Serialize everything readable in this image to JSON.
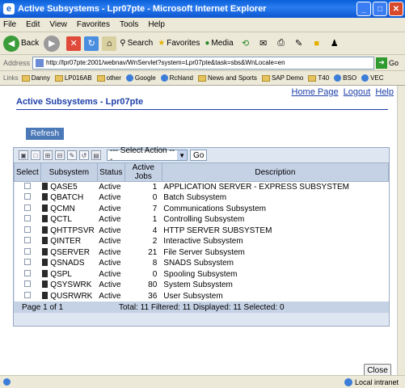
{
  "window": {
    "title": "Active Subsystems - Lpr07pte - Microsoft Internet Explorer",
    "icon": "ie-icon"
  },
  "menu": [
    "File",
    "Edit",
    "View",
    "Favorites",
    "Tools",
    "Help"
  ],
  "toolbar": {
    "back": "Back",
    "search": "Search",
    "favorites": "Favorites",
    "media": "Media"
  },
  "address": {
    "label": "Address",
    "url": "http://lpr07pte:2001/webnav/WnServlet?system=Lpr07pte&task=sbs&WnLocale=en",
    "go": "Go"
  },
  "links": {
    "label": "Links",
    "items": [
      "Danny",
      "LP016AB",
      "other",
      "Google",
      "Rchland",
      "News and Sports",
      "SAP Demo",
      "T40",
      "BSO",
      "VEC"
    ]
  },
  "page": {
    "top_links": [
      "Home Page",
      "Logout",
      "Help"
    ],
    "title": "Active Subsystems - Lpr07pte",
    "refresh_label": "Refresh",
    "select_action": "--- Select Action ---",
    "go_label": "Go",
    "headers": [
      "Select",
      "Subsystem",
      "Status",
      "Active Jobs",
      "Description"
    ],
    "rows": [
      {
        "subsystem": "QASE5",
        "status": "Active",
        "jobs": "1",
        "desc": "APPLICATION SERVER - EXPRESS SUBSYSTEM"
      },
      {
        "subsystem": "QBATCH",
        "status": "Active",
        "jobs": "0",
        "desc": "Batch Subsystem"
      },
      {
        "subsystem": "QCMN",
        "status": "Active",
        "jobs": "7",
        "desc": "Communications Subsystem"
      },
      {
        "subsystem": "QCTL",
        "status": "Active",
        "jobs": "1",
        "desc": "Controlling Subsystem"
      },
      {
        "subsystem": "QHTTPSVR",
        "status": "Active",
        "jobs": "4",
        "desc": "HTTP SERVER SUBSYSTEM"
      },
      {
        "subsystem": "QINTER",
        "status": "Active",
        "jobs": "2",
        "desc": "Interactive Subsystem"
      },
      {
        "subsystem": "QSERVER",
        "status": "Active",
        "jobs": "21",
        "desc": "File Server Subsystem"
      },
      {
        "subsystem": "QSNADS",
        "status": "Active",
        "jobs": "8",
        "desc": "SNADS Subsystem"
      },
      {
        "subsystem": "QSPL",
        "status": "Active",
        "jobs": "0",
        "desc": "Spooling Subsystem"
      },
      {
        "subsystem": "QSYSWRK",
        "status": "Active",
        "jobs": "80",
        "desc": "System Subsystem"
      },
      {
        "subsystem": "QUSRWRK",
        "status": "Active",
        "jobs": "36",
        "desc": "User Subsystem"
      }
    ],
    "footer": {
      "page": "Page 1 of 1",
      "summary": "Total: 11  Filtered: 11  Displayed: 11  Selected: 0"
    },
    "close_label": "Close"
  },
  "status": {
    "zone": "Local intranet"
  }
}
